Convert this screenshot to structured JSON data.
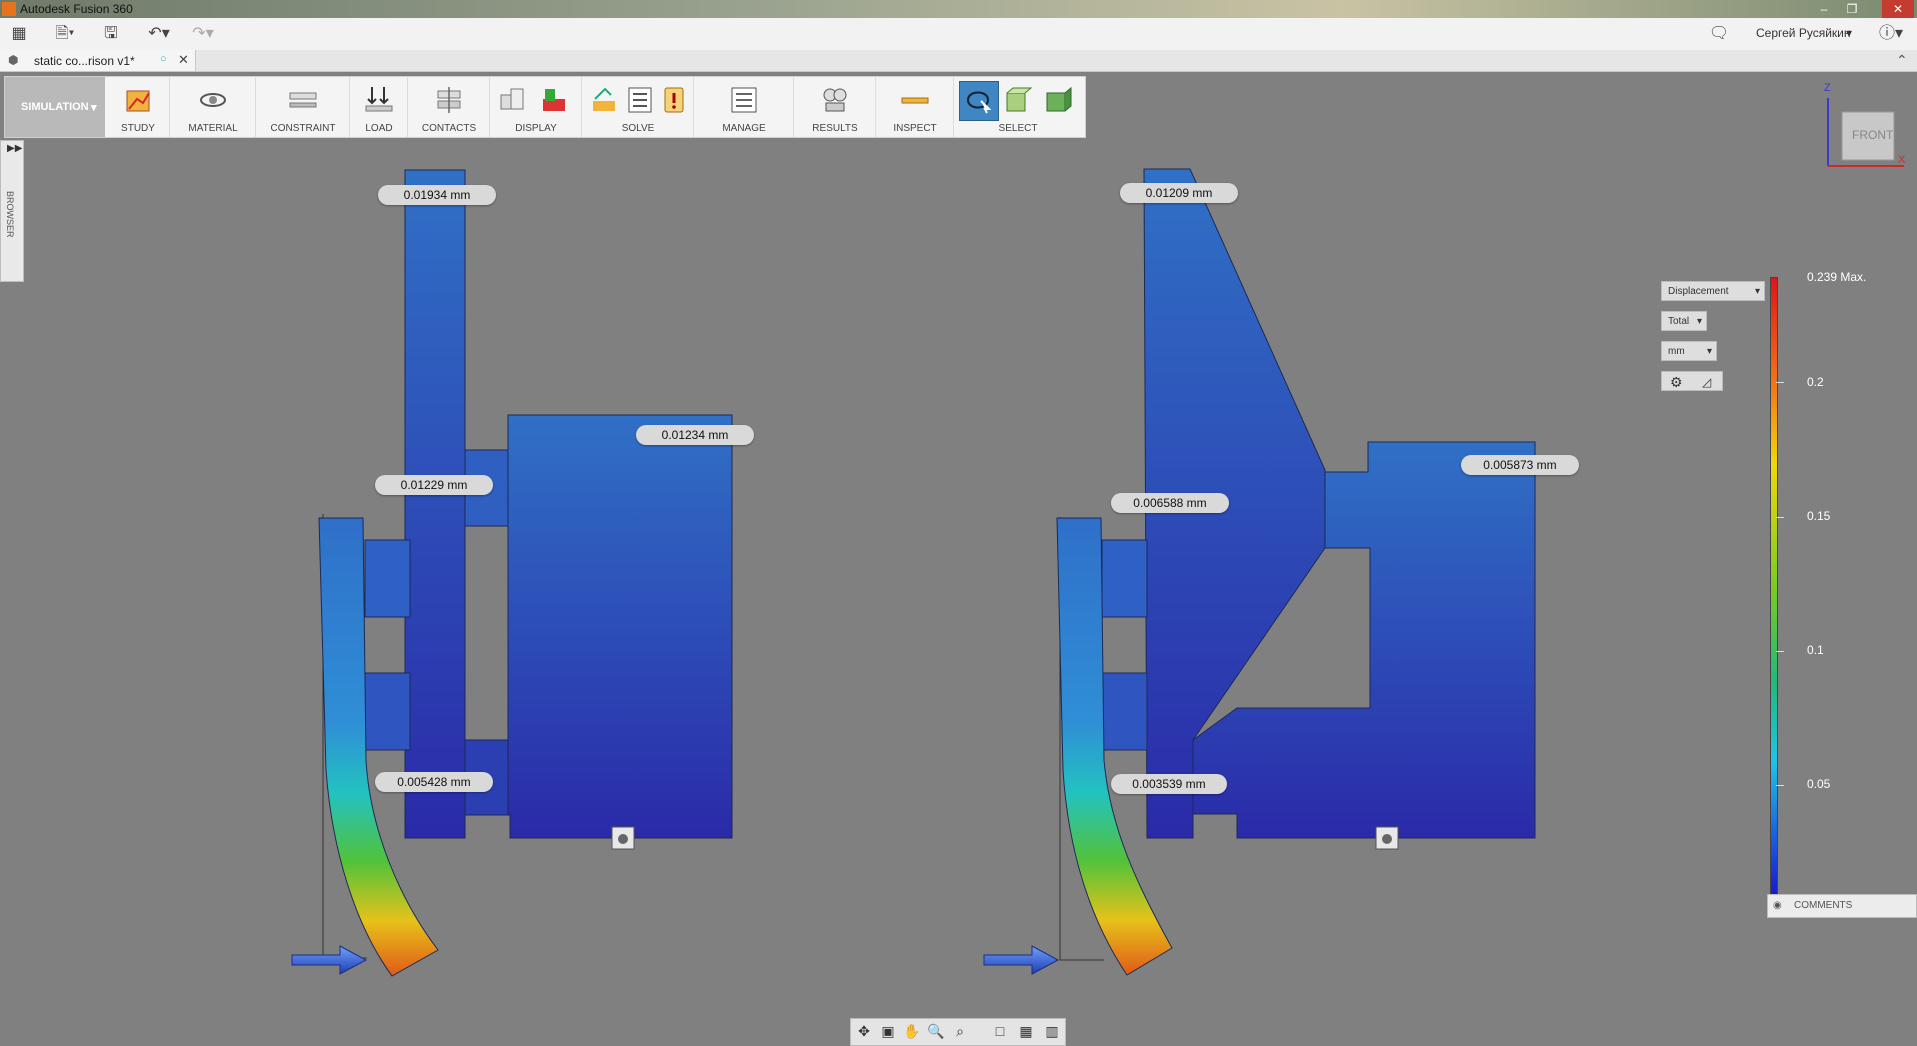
{
  "window": {
    "title": "Autodesk Fusion 360"
  },
  "user": {
    "name": "Сергей Русяйкин"
  },
  "document_tab": {
    "label": "static co...rison v1*"
  },
  "workspace": {
    "label": "SIMULATION"
  },
  "toolbar": {
    "groups": [
      "STUDY",
      "MATERIAL",
      "CONSTRAINT",
      "LOAD",
      "CONTACTS",
      "DISPLAY",
      "SOLVE",
      "MANAGE",
      "RESULTS",
      "INSPECT",
      "SELECT"
    ]
  },
  "browser": {
    "label": "BROWSER"
  },
  "viewcube": {
    "face": "FRONT",
    "z_axis": "Z",
    "x_axis": "X"
  },
  "result_legend": {
    "type": "Displacement",
    "component": "Total",
    "unit": "mm",
    "max_label": "0.239 Max.",
    "ticks": [
      "0.2",
      "0.15",
      "0.1",
      "0.05"
    ],
    "colors": {
      "max": "#e0141b",
      "min": "#1a16c9"
    }
  },
  "probes_left": {
    "p1": "0.01934 mm",
    "p2": "0.01234 mm",
    "p3": "0.01229 mm",
    "p4": "0.005428 mm"
  },
  "probes_right": {
    "p1": "0.01209 mm",
    "p2": "0.005873 mm",
    "p3": "0.006588 mm",
    "p4": "0.003539 mm"
  },
  "comments": {
    "label": "COMMENTS"
  }
}
